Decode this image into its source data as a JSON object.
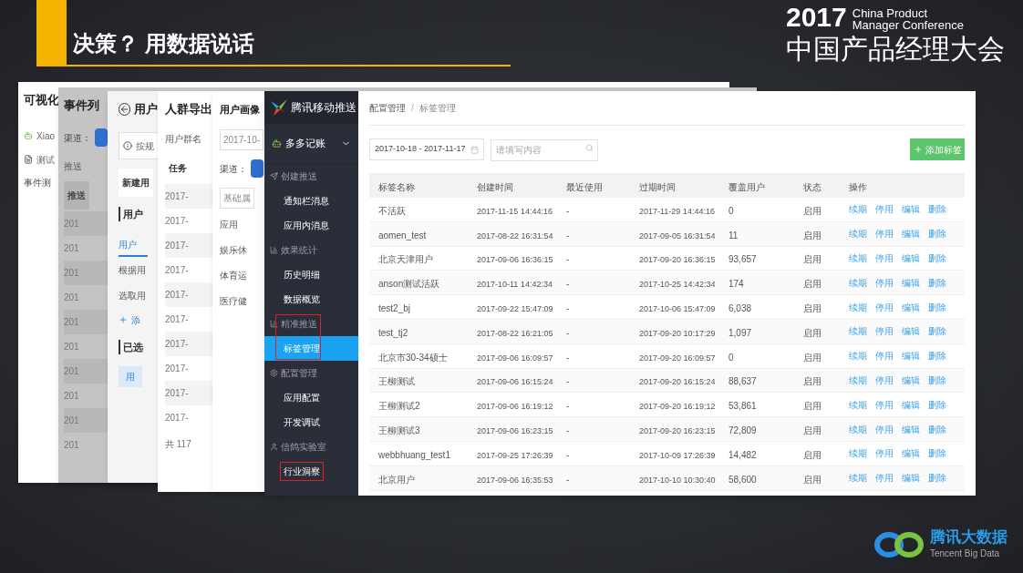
{
  "slide": {
    "title": "决策？ 用数据说话",
    "conference": {
      "year": "2017",
      "name_en_1": "China Product",
      "name_en_2": "Manager Conference",
      "name_cn": "中国产品经理大会"
    },
    "brand": {
      "name_cn": "腾讯大数据",
      "name_en": "Tencent Big Data"
    }
  },
  "background_windows": [
    {
      "items": [
        {
          "kind": "title",
          "text": "可视化"
        },
        {
          "kind": "app",
          "text": "Xiao"
        },
        {
          "kind": "doc",
          "text": "测试"
        },
        {
          "kind": "text",
          "text": "事件测"
        }
      ]
    },
    {
      "items": [
        {
          "kind": "title",
          "text": "事件列"
        },
        {
          "kind": "channel",
          "text": "渠道："
        },
        {
          "kind": "text",
          "text": "推送"
        },
        {
          "kind": "header",
          "text": "推送"
        },
        {
          "kind": "row",
          "text": "201"
        },
        {
          "kind": "row",
          "text": "201"
        },
        {
          "kind": "row",
          "text": "201"
        },
        {
          "kind": "row",
          "text": "201"
        },
        {
          "kind": "row",
          "text": "201"
        },
        {
          "kind": "row",
          "text": "201"
        },
        {
          "kind": "row",
          "text": "201"
        },
        {
          "kind": "row",
          "text": "201"
        },
        {
          "kind": "row",
          "text": "201"
        },
        {
          "kind": "row",
          "text": "201"
        }
      ]
    },
    {
      "items": [
        {
          "kind": "back",
          "text": "用户"
        },
        {
          "kind": "info",
          "text": "按规"
        },
        {
          "kind": "header",
          "text": "新建用"
        },
        {
          "kind": "section",
          "text": "用户"
        },
        {
          "kind": "tab",
          "text": "用户",
          "selected": true
        },
        {
          "kind": "text",
          "text": "根据用"
        },
        {
          "kind": "text",
          "text": "选取用"
        },
        {
          "kind": "link",
          "text": "添"
        },
        {
          "kind": "section",
          "text": "已选"
        },
        {
          "kind": "chip",
          "text": "用"
        }
      ]
    },
    {
      "items": [
        {
          "kind": "title",
          "text": "人群导出"
        },
        {
          "kind": "text",
          "text": "用户群名"
        },
        {
          "kind": "header",
          "text": "任务"
        },
        {
          "kind": "row",
          "text": "2017-"
        },
        {
          "kind": "row",
          "text": "2017-"
        },
        {
          "kind": "row",
          "text": "2017-"
        },
        {
          "kind": "row",
          "text": "2017-"
        },
        {
          "kind": "row",
          "text": "2017-"
        },
        {
          "kind": "row",
          "text": "2017-"
        },
        {
          "kind": "row",
          "text": "2017-"
        },
        {
          "kind": "row",
          "text": "2017-"
        },
        {
          "kind": "row",
          "text": "2017-"
        },
        {
          "kind": "row",
          "text": "2017-"
        },
        {
          "kind": "footer",
          "text": "共 117"
        }
      ]
    },
    {
      "items": [
        {
          "kind": "title",
          "text": "用户画像"
        },
        {
          "kind": "field",
          "text": "2017-10-"
        },
        {
          "kind": "channel",
          "text": "渠道："
        },
        {
          "kind": "field",
          "text": "基础属"
        },
        {
          "kind": "text",
          "text": "应用"
        },
        {
          "kind": "text",
          "text": "娱乐休"
        },
        {
          "kind": "text",
          "text": "体育运"
        },
        {
          "kind": "text",
          "text": "医疗健"
        }
      ]
    }
  ],
  "app": {
    "logo_text": "腾讯移动推送",
    "app_name": "多多记账",
    "nav": [
      {
        "label": "创建推送",
        "boxed": false,
        "children": [
          {
            "label": "通知栏消息",
            "selected": false,
            "boxed": false
          },
          {
            "label": "应用内消息",
            "selected": false,
            "boxed": false
          }
        ]
      },
      {
        "label": "效果统计",
        "boxed": false,
        "children": [
          {
            "label": "历史明细",
            "selected": false,
            "boxed": false
          },
          {
            "label": "数据概览",
            "selected": false,
            "boxed": false
          }
        ]
      },
      {
        "label": "精准推送",
        "boxed": true,
        "children": [
          {
            "label": "标签管理",
            "selected": true,
            "boxed": false
          }
        ]
      },
      {
        "label": "配置管理",
        "boxed": false,
        "children": [
          {
            "label": "应用配置",
            "selected": false,
            "boxed": false
          },
          {
            "label": "开发调试",
            "selected": false,
            "boxed": false
          }
        ]
      },
      {
        "label": "信鸽实验室",
        "boxed": false,
        "children": [
          {
            "label": "行业洞察",
            "selected": false,
            "boxed": true
          }
        ]
      }
    ],
    "breadcrumb": [
      "配置管理",
      "标签管理"
    ],
    "breadcrumb_separator": "/",
    "date_range": "2017-10-18 - 2017-11-17",
    "search_placeholder": "请填写内容",
    "add_button": "添加标签",
    "table": {
      "columns": [
        "标签名称",
        "创建时间",
        "最近使用",
        "过期时间",
        "覆盖用户",
        "状态",
        "操作"
      ],
      "rows": [
        {
          "cells": [
            "不活跃",
            "2017-11-15 14:44:16",
            "-",
            "2017-11-29 14:44:16",
            "0",
            "启用"
          ],
          "actions": [
            "续期",
            "停用",
            "编辑",
            "删除"
          ]
        },
        {
          "cells": [
            "aomen_test",
            "2017-08-22 16:31:54",
            "-",
            "2017-09-05 16:31:54",
            "11",
            "启用"
          ],
          "actions": [
            "续期",
            "停用",
            "编辑",
            "删除"
          ]
        },
        {
          "cells": [
            "北京天津用户",
            "2017-09-06 16:36:15",
            "-",
            "2017-09-20 16:36:15",
            "93,657",
            "启用"
          ],
          "actions": [
            "续期",
            "停用",
            "编辑",
            "删除"
          ]
        },
        {
          "cells": [
            "anson测试活跃",
            "2017-10-11 14:42:34",
            "-",
            "2017-10-25 14:42:34",
            "174",
            "启用"
          ],
          "actions": [
            "续期",
            "停用",
            "编辑",
            "删除"
          ]
        },
        {
          "cells": [
            "test2_bj",
            "2017-09-22 15:47:09",
            "-",
            "2017-10-06 15:47:09",
            "6,038",
            "启用"
          ],
          "actions": [
            "续期",
            "停用",
            "编辑",
            "删除"
          ]
        },
        {
          "cells": [
            "test_tj2",
            "2017-08-22 16:21:05",
            "-",
            "2017-09-20 10:17:29",
            "1,097",
            "启用"
          ],
          "actions": [
            "续期",
            "停用",
            "编辑",
            "删除"
          ]
        },
        {
          "cells": [
            "北京市30-34硕士",
            "2017-09-06 16:09:57",
            "-",
            "2017-09-20 16:09:57",
            "0",
            "启用"
          ],
          "actions": [
            "续期",
            "停用",
            "编辑",
            "删除"
          ]
        },
        {
          "cells": [
            "王柳测试",
            "2017-09-06 16:15:24",
            "-",
            "2017-09-20 16:15:24",
            "88,637",
            "启用"
          ],
          "actions": [
            "续期",
            "停用",
            "编辑",
            "删除"
          ]
        },
        {
          "cells": [
            "王柳测试2",
            "2017-09-06 16:19:12",
            "-",
            "2017-09-20 16:19:12",
            "53,861",
            "启用"
          ],
          "actions": [
            "续期",
            "停用",
            "编辑",
            "删除"
          ]
        },
        {
          "cells": [
            "王柳测试3",
            "2017-09-06 16:23:15",
            "-",
            "2017-09-20 16:23:15",
            "72,809",
            "启用"
          ],
          "actions": [
            "续期",
            "停用",
            "编辑",
            "删除"
          ]
        },
        {
          "cells": [
            "webbhuang_test1",
            "2017-09-25 17:26:39",
            "-",
            "2017-10-09 17:26:39",
            "14,482",
            "启用"
          ],
          "actions": [
            "续期",
            "停用",
            "编辑",
            "删除"
          ]
        },
        {
          "cells": [
            "北京用户",
            "2017-09-06 16:35:53",
            "-",
            "2017-10-10 10:30:40",
            "58,600",
            "启用"
          ],
          "actions": [
            "续期",
            "停用",
            "编辑",
            "删除"
          ]
        }
      ]
    }
  }
}
